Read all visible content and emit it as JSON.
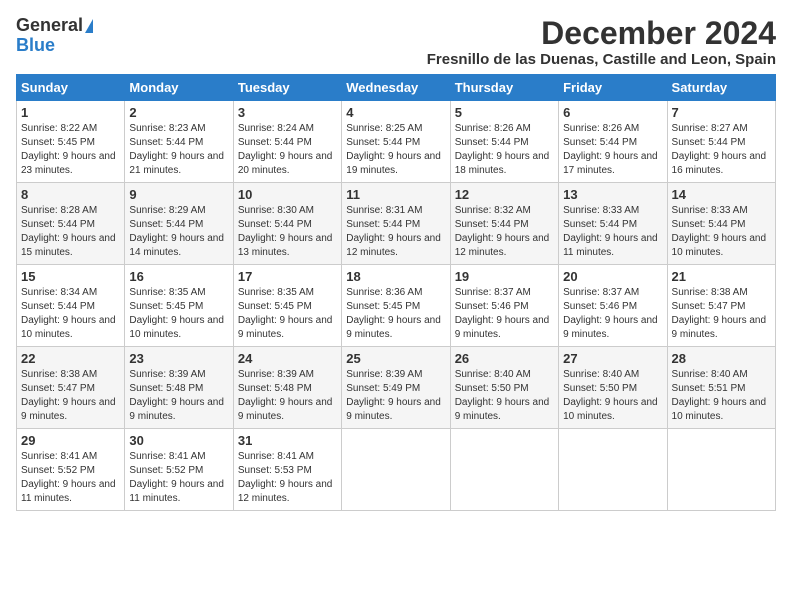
{
  "logo": {
    "general": "General",
    "blue": "Blue"
  },
  "title": "December 2024",
  "location": "Fresnillo de las Duenas, Castille and Leon, Spain",
  "days_of_week": [
    "Sunday",
    "Monday",
    "Tuesday",
    "Wednesday",
    "Thursday",
    "Friday",
    "Saturday"
  ],
  "weeks": [
    [
      {
        "day": "1",
        "sunrise": "8:22 AM",
        "sunset": "5:45 PM",
        "daylight": "9 hours and 23 minutes."
      },
      {
        "day": "2",
        "sunrise": "8:23 AM",
        "sunset": "5:44 PM",
        "daylight": "9 hours and 21 minutes."
      },
      {
        "day": "3",
        "sunrise": "8:24 AM",
        "sunset": "5:44 PM",
        "daylight": "9 hours and 20 minutes."
      },
      {
        "day": "4",
        "sunrise": "8:25 AM",
        "sunset": "5:44 PM",
        "daylight": "9 hours and 19 minutes."
      },
      {
        "day": "5",
        "sunrise": "8:26 AM",
        "sunset": "5:44 PM",
        "daylight": "9 hours and 18 minutes."
      },
      {
        "day": "6",
        "sunrise": "8:26 AM",
        "sunset": "5:44 PM",
        "daylight": "9 hours and 17 minutes."
      },
      {
        "day": "7",
        "sunrise": "8:27 AM",
        "sunset": "5:44 PM",
        "daylight": "9 hours and 16 minutes."
      }
    ],
    [
      {
        "day": "8",
        "sunrise": "8:28 AM",
        "sunset": "5:44 PM",
        "daylight": "9 hours and 15 minutes."
      },
      {
        "day": "9",
        "sunrise": "8:29 AM",
        "sunset": "5:44 PM",
        "daylight": "9 hours and 14 minutes."
      },
      {
        "day": "10",
        "sunrise": "8:30 AM",
        "sunset": "5:44 PM",
        "daylight": "9 hours and 13 minutes."
      },
      {
        "day": "11",
        "sunrise": "8:31 AM",
        "sunset": "5:44 PM",
        "daylight": "9 hours and 12 minutes."
      },
      {
        "day": "12",
        "sunrise": "8:32 AM",
        "sunset": "5:44 PM",
        "daylight": "9 hours and 12 minutes."
      },
      {
        "day": "13",
        "sunrise": "8:33 AM",
        "sunset": "5:44 PM",
        "daylight": "9 hours and 11 minutes."
      },
      {
        "day": "14",
        "sunrise": "8:33 AM",
        "sunset": "5:44 PM",
        "daylight": "9 hours and 10 minutes."
      }
    ],
    [
      {
        "day": "15",
        "sunrise": "8:34 AM",
        "sunset": "5:44 PM",
        "daylight": "9 hours and 10 minutes."
      },
      {
        "day": "16",
        "sunrise": "8:35 AM",
        "sunset": "5:45 PM",
        "daylight": "9 hours and 10 minutes."
      },
      {
        "day": "17",
        "sunrise": "8:35 AM",
        "sunset": "5:45 PM",
        "daylight": "9 hours and 9 minutes."
      },
      {
        "day": "18",
        "sunrise": "8:36 AM",
        "sunset": "5:45 PM",
        "daylight": "9 hours and 9 minutes."
      },
      {
        "day": "19",
        "sunrise": "8:37 AM",
        "sunset": "5:46 PM",
        "daylight": "9 hours and 9 minutes."
      },
      {
        "day": "20",
        "sunrise": "8:37 AM",
        "sunset": "5:46 PM",
        "daylight": "9 hours and 9 minutes."
      },
      {
        "day": "21",
        "sunrise": "8:38 AM",
        "sunset": "5:47 PM",
        "daylight": "9 hours and 9 minutes."
      }
    ],
    [
      {
        "day": "22",
        "sunrise": "8:38 AM",
        "sunset": "5:47 PM",
        "daylight": "9 hours and 9 minutes."
      },
      {
        "day": "23",
        "sunrise": "8:39 AM",
        "sunset": "5:48 PM",
        "daylight": "9 hours and 9 minutes."
      },
      {
        "day": "24",
        "sunrise": "8:39 AM",
        "sunset": "5:48 PM",
        "daylight": "9 hours and 9 minutes."
      },
      {
        "day": "25",
        "sunrise": "8:39 AM",
        "sunset": "5:49 PM",
        "daylight": "9 hours and 9 minutes."
      },
      {
        "day": "26",
        "sunrise": "8:40 AM",
        "sunset": "5:50 PM",
        "daylight": "9 hours and 9 minutes."
      },
      {
        "day": "27",
        "sunrise": "8:40 AM",
        "sunset": "5:50 PM",
        "daylight": "9 hours and 10 minutes."
      },
      {
        "day": "28",
        "sunrise": "8:40 AM",
        "sunset": "5:51 PM",
        "daylight": "9 hours and 10 minutes."
      }
    ],
    [
      {
        "day": "29",
        "sunrise": "8:41 AM",
        "sunset": "5:52 PM",
        "daylight": "9 hours and 11 minutes."
      },
      {
        "day": "30",
        "sunrise": "8:41 AM",
        "sunset": "5:52 PM",
        "daylight": "9 hours and 11 minutes."
      },
      {
        "day": "31",
        "sunrise": "8:41 AM",
        "sunset": "5:53 PM",
        "daylight": "9 hours and 12 minutes."
      },
      null,
      null,
      null,
      null
    ]
  ]
}
